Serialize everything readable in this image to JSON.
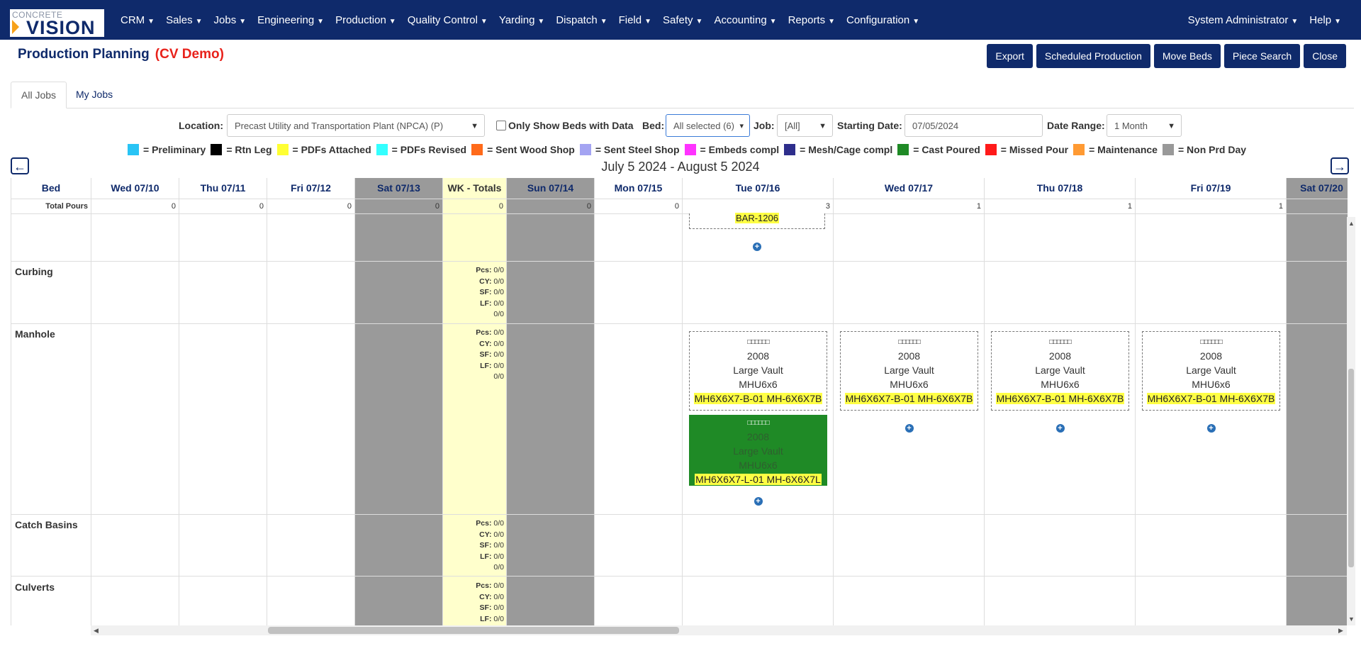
{
  "app": {
    "logo_small": "CONCRETE",
    "logo_big": "VISION"
  },
  "nav": {
    "left": [
      "CRM",
      "Sales",
      "Jobs",
      "Engineering",
      "Production",
      "Quality Control",
      "Yarding",
      "Dispatch",
      "Field",
      "Safety",
      "Accounting",
      "Reports",
      "Configuration"
    ],
    "right": [
      "System Administrator",
      "Help"
    ]
  },
  "header": {
    "title": "Production Planning",
    "company": "(CV Demo)",
    "buttons": [
      "Export",
      "Scheduled Production",
      "Move Beds",
      "Piece Search",
      "Close"
    ]
  },
  "tabs": [
    "All Jobs",
    "My Jobs"
  ],
  "filters": {
    "location_label": "Location:",
    "location_value": "Precast Utility and Transportation Plant (NPCA) (P)",
    "only_beds_label": "Only Show Beds with Data",
    "only_beds_checked": false,
    "bed_label": "Bed:",
    "bed_value": "All selected (6)",
    "job_label": "Job:",
    "job_value": "[All]",
    "start_label": "Starting Date:",
    "start_value": "07/05/2024",
    "range_label": "Date Range:",
    "range_value": "1 Month"
  },
  "legend": [
    {
      "label": "= Preliminary",
      "color": "#29c4f5"
    },
    {
      "label": "= Rtn Leg",
      "color": "#000000"
    },
    {
      "label": "= PDFs Attached",
      "color": "#ffff33"
    },
    {
      "label": "= PDFs Revised",
      "color": "#33ffff"
    },
    {
      "label": "= Sent Wood Shop",
      "color": "#ff6a1a"
    },
    {
      "label": "= Sent Steel Shop",
      "color": "#a4a4f2"
    },
    {
      "label": "= Embeds compl",
      "color": "#ff33ff"
    },
    {
      "label": "= Mesh/Cage compl",
      "color": "#2e2e8c"
    },
    {
      "label": "= Cast Poured",
      "color": "#1f8a26"
    },
    {
      "label": "= Missed Pour",
      "color": "#ff1a1a"
    },
    {
      "label": "= Maintenance",
      "color": "#ff9a33"
    },
    {
      "label": "= Non Prd Day",
      "color": "#999999"
    }
  ],
  "date_range_text": "July 5 2024 - August 5 2024",
  "grid": {
    "bed_header": "Bed",
    "total_pours_label": "Total Pours",
    "columns": [
      {
        "label": "Wed 07/10",
        "type": "day",
        "pours": "0"
      },
      {
        "label": "Thu 07/11",
        "type": "day",
        "pours": "0"
      },
      {
        "label": "Fri 07/12",
        "type": "day",
        "pours": "0"
      },
      {
        "label": "Sat 07/13",
        "type": "weekend",
        "pours": "0"
      },
      {
        "label": "WK - Totals",
        "type": "totals",
        "pours": "0"
      },
      {
        "label": "Sun 07/14",
        "type": "weekend",
        "pours": "0"
      },
      {
        "label": "Mon 07/15",
        "type": "day",
        "pours": "0"
      },
      {
        "label": "Tue 07/16",
        "type": "day",
        "pours": "3"
      },
      {
        "label": "Wed 07/17",
        "type": "day",
        "pours": "1"
      },
      {
        "label": "Thu 07/18",
        "type": "day",
        "pours": "1"
      },
      {
        "label": "Fri 07/19",
        "type": "day",
        "pours": "1"
      },
      {
        "label": "Sat 07/20",
        "type": "weekend",
        "pours": ""
      }
    ],
    "beds": [
      "Curbing",
      "Manhole",
      "Catch Basins",
      "Culverts"
    ],
    "totals_labels": [
      "Pcs:",
      "CY:",
      "SF:",
      "LF:",
      ""
    ],
    "totals_values": [
      "0/0",
      "0/0",
      "0/0",
      "0/0",
      "0/0"
    ],
    "partial_card_label": "BAR-1206",
    "cards": [
      {
        "boxes": "□□□□□□",
        "year": "2008",
        "type": "Large Vault",
        "model": "MHU6x6",
        "mark": "MH6X6X7-B-01 MH-6X6X7B"
      },
      {
        "boxes": "□□□□□□",
        "year": "2008",
        "type": "Large Vault",
        "model": "MHU6x6",
        "mark": "MH6X6X7-B-01 MH-6X6X7B"
      },
      {
        "boxes": "□□□□□□",
        "year": "2008",
        "type": "Large Vault",
        "model": "MHU6x6",
        "mark": "MH6X6X7-B-01 MH-6X6X7B"
      },
      {
        "boxes": "□□□□□□",
        "year": "2008",
        "type": "Large Vault",
        "model": "MHU6x6",
        "mark": "MH6X6X7-B-01 MH-6X6X7B"
      },
      {
        "boxes": "□□□□□□",
        "year": "2008",
        "type": "Large Vault",
        "model": "MHU6x6",
        "mark": "MH6X6X7-L-01 MH-6X6X7L",
        "status": "Cast Poured"
      }
    ]
  }
}
